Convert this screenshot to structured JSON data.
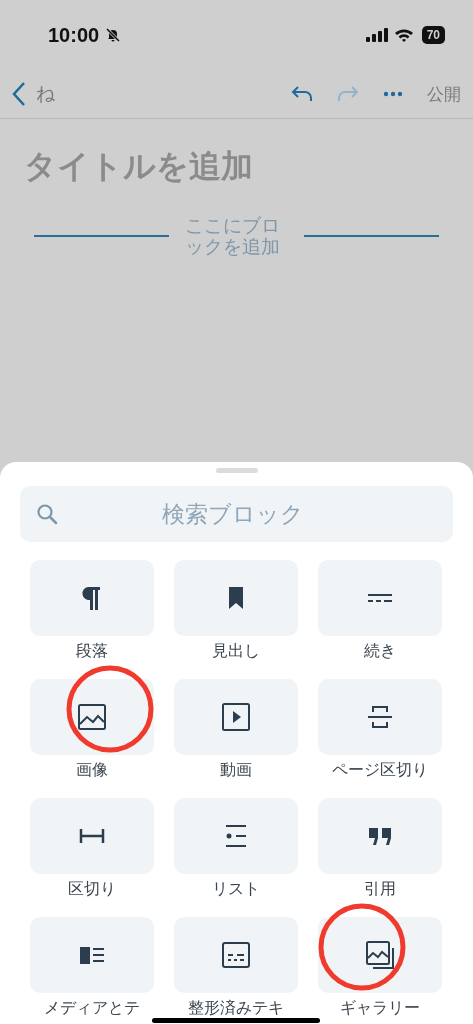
{
  "status_bar": {
    "time": "10:00",
    "muted": true,
    "battery": "70"
  },
  "nav": {
    "back_label": "ね",
    "undo_disabled": false,
    "redo_disabled": true,
    "publish": "公開"
  },
  "editor": {
    "title_placeholder": "タイトルを追加",
    "add_block": "ここにブロックを追加"
  },
  "inserter": {
    "search": {
      "placeholder": "検索ブロック"
    },
    "blocks": [
      {
        "kind": "paragraph",
        "label": "段落",
        "circled": false
      },
      {
        "kind": "heading",
        "label": "見出し",
        "circled": false
      },
      {
        "kind": "more",
        "label": "続き",
        "circled": false
      },
      {
        "kind": "image",
        "label": "画像",
        "circled": true
      },
      {
        "kind": "video",
        "label": "動画",
        "circled": false
      },
      {
        "kind": "pagebreak",
        "label": "ページ区切り",
        "circled": false
      },
      {
        "kind": "separator",
        "label": "区切り",
        "circled": false
      },
      {
        "kind": "list",
        "label": "リスト",
        "circled": false
      },
      {
        "kind": "quote",
        "label": "引用",
        "circled": false
      },
      {
        "kind": "mediatext",
        "label": "メディアとテ",
        "circled": false
      },
      {
        "kind": "preformatted",
        "label": "整形済みテキ",
        "circled": false
      },
      {
        "kind": "gallery",
        "label": "ギャラリー",
        "circled": true
      }
    ]
  }
}
